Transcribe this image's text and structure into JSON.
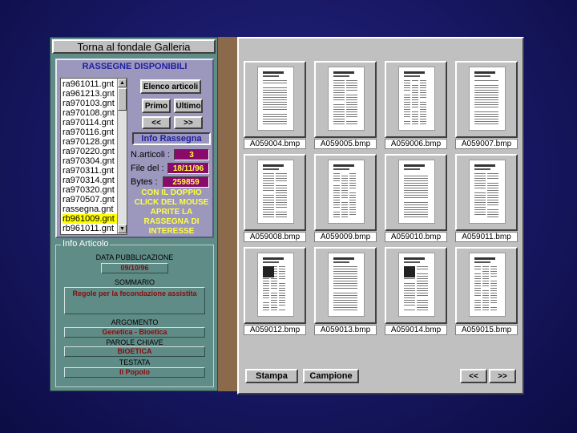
{
  "top_button": "Torna al fondale Galleria",
  "rassegne": {
    "title": "RASSEGNE DISPONIBILI",
    "files": [
      "ra961011.gnt",
      "ra961213.gnt",
      "ra970103.gnt",
      "ra970108.gnt",
      "ra970114.gnt",
      "ra970116.gnt",
      "ra970128.gnt",
      "ra970220.gnt",
      "ra970304.gnt",
      "ra970311.gnt",
      "ra970314.gnt",
      "ra970320.gnt",
      "ra970507.gnt",
      "rassegna.gnt",
      "rb961009.gnt",
      "rb961011.gnt"
    ],
    "selected_index": 14,
    "buttons": {
      "elenco": "Elenco articoli",
      "primo": "Primo",
      "ultimo": "Ultimo",
      "prev": "<<",
      "next": ">>"
    },
    "info_title": "Info Rassegna",
    "n_articoli_label": "N.articoli :",
    "n_articoli": "3",
    "file_del_label": "File del :",
    "file_del": "18/11/96",
    "bytes_label": "Bytes :",
    "bytes": "259859",
    "instruction": "CON IL DOPPIO CLICK DEL MOUSE APRITE LA RASSEGNA DI INTERESSE"
  },
  "info_articolo": {
    "title": "Info Articolo",
    "data_label": "DATA PUBBLICAZIONE",
    "data": "09/10/96",
    "sommario_label": "SOMMARIO",
    "sommario": "Regole per la fecondazione assistita",
    "argomento_label": "ARGOMENTO",
    "argomento": "Genetica - Bioetica",
    "parole_label": "PAROLE CHIAVE",
    "parole": "BIOETICA",
    "testata_label": "TESTATA",
    "testata": "Il Popolo"
  },
  "gallery": {
    "thumbnails": [
      "A059004.bmp",
      "A059005.bmp",
      "A059006.bmp",
      "A059007.bmp",
      "A059008.bmp",
      "A059009.bmp",
      "A059010.bmp",
      "A059011.bmp",
      "A059012.bmp",
      "A059013.bmp",
      "A059014.bmp",
      "A059015.bmp"
    ],
    "stampa": "Stampa",
    "campione": "Campione",
    "prev": "<<",
    "next": ">>"
  },
  "colors": {
    "panel": "#608c88",
    "lavender": "#9c97bd",
    "value_bg": "#8a0a6a",
    "value_fg": "#ffff40",
    "selected": "#ffff00"
  }
}
